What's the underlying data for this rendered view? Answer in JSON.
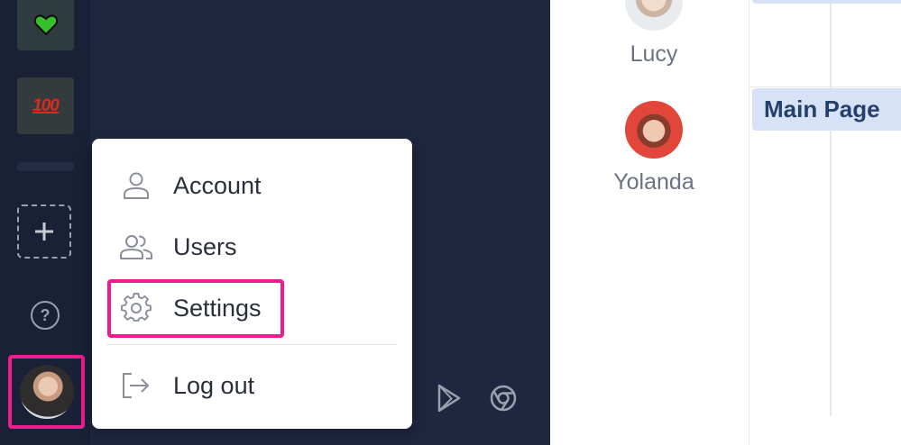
{
  "menu": {
    "items": [
      {
        "label": "Account",
        "icon": "person-icon"
      },
      {
        "label": "Users",
        "icon": "users-icon"
      },
      {
        "label": "Settings",
        "icon": "gear-icon"
      },
      {
        "label": "Log out",
        "icon": "logout-icon"
      }
    ]
  },
  "rail": {
    "tile_100": "100",
    "help": "?"
  },
  "people": [
    {
      "name": "Lucy"
    },
    {
      "name": "Yolanda"
    }
  ],
  "tasks": {
    "main_page": "Main Page"
  },
  "colors": {
    "accent_highlight": "#ee1c8e",
    "rail_bg": "#1a2036",
    "panel_bg": "#1f2640",
    "task_bg": "#d7e2f6",
    "task_text": "#26406c"
  }
}
